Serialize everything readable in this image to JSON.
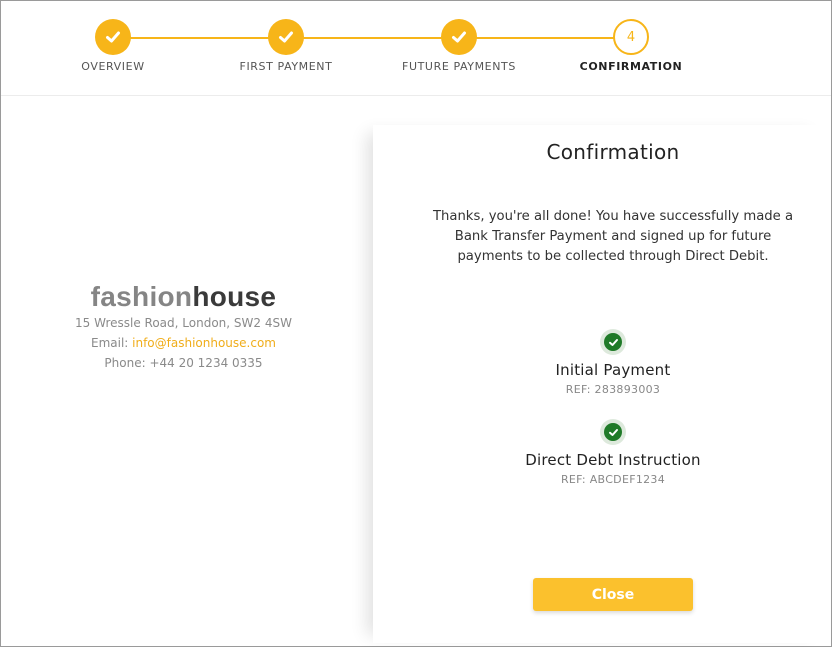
{
  "stepper": {
    "steps": [
      {
        "label": "OVERVIEW",
        "state": "done"
      },
      {
        "label": "FIRST PAYMENT",
        "state": "done"
      },
      {
        "label": "FUTURE PAYMENTS",
        "state": "done"
      },
      {
        "label": "CONFIRMATION",
        "state": "current",
        "number": "4"
      }
    ],
    "accent_color": "#f7b519"
  },
  "merchant": {
    "logo_part1": "fashion",
    "logo_part2": "house",
    "address": "15 Wressle Road, London, SW2 4SW",
    "email_label": "Email: ",
    "email": "info@fashionhouse.com",
    "phone": "Phone: +44 20 1234 0335"
  },
  "confirmation": {
    "title": "Confirmation",
    "message": "Thanks, you're all done! You have successfully made a Bank Transfer Payment and signed up for future payments to be collected through Direct Debit.",
    "items": [
      {
        "title": "Initial Payment",
        "ref": "REF: 283893003",
        "icon": "check-circle-icon"
      },
      {
        "title": "Direct Debt Instruction",
        "ref": "REF: ABCDEF1234",
        "icon": "check-circle-icon"
      }
    ],
    "close_label": "Close",
    "button_color": "#fbc12d",
    "success_color": "#1f7a28"
  }
}
